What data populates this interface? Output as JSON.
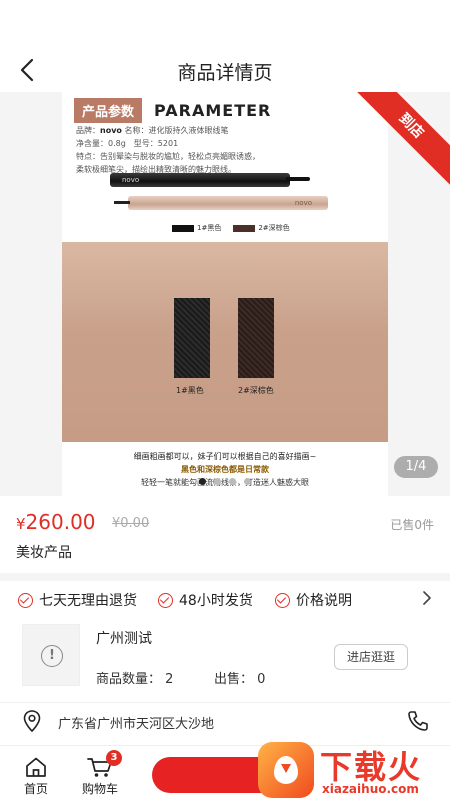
{
  "header": {
    "title": "商品详情页"
  },
  "gallery": {
    "param_tag": "产品参数",
    "param_en": "PARAMETER",
    "spec_brand_label": "品牌：",
    "spec_brand": "novo",
    "spec_name": "名称：进化版持久液体眼线笔",
    "spec_size": "净含量：0.8g　型号：5201",
    "spec_feature": "特点：告别晕染与脱妆的尴尬，轻松点亮媚眼诱惑，柔软极细笔尖，描绘出精致清晰的魅力眼线。",
    "pen_brand_black": "novo",
    "pen_brand_rose": "novo",
    "swatch_black": "1#黑色",
    "swatch_brown": "2#深棕色",
    "stroke_label_black": "1#黑色",
    "stroke_label_brown": "2#深棕色",
    "caption1": "细画粗画都可以，妹子们可以根据自己的喜好描画~",
    "caption2": "黑色和深棕色都是日常款",
    "caption3": "轻轻一笔就能勾画流畅线条，打造迷人魅惑大眼",
    "ribbon": "到店",
    "pager": "1/4",
    "slide_count": 4,
    "active_slide": 1
  },
  "product": {
    "currency": "¥",
    "price": "260.00",
    "original_price": "¥0.00",
    "sold": "已售0件",
    "name": "美妆产品"
  },
  "services": [
    {
      "label": "七天无理由退货"
    },
    {
      "label": "48小时发货"
    },
    {
      "label": "价格说明"
    }
  ],
  "store": {
    "name": "广州测试",
    "quantity": "商品数量：  2",
    "sold": "出售：  0",
    "visit_label": "进店逛逛"
  },
  "address": {
    "text": "广东省广州市天河区大沙地"
  },
  "tabbar": {
    "home_label": "首页",
    "cart_label": "购物车",
    "cart_count": "3"
  },
  "watermark": {
    "text": "下载火",
    "url": "xiazaihuo.com"
  },
  "colors": {
    "accent": "#e02e24",
    "ribbon": "#e02e24",
    "param_tag": "#b97a66"
  },
  "icons": [
    "back-icon",
    "check-icon",
    "chevron-right-icon",
    "info-icon",
    "location-pin-icon",
    "phone-icon",
    "home-icon",
    "cart-icon"
  ]
}
